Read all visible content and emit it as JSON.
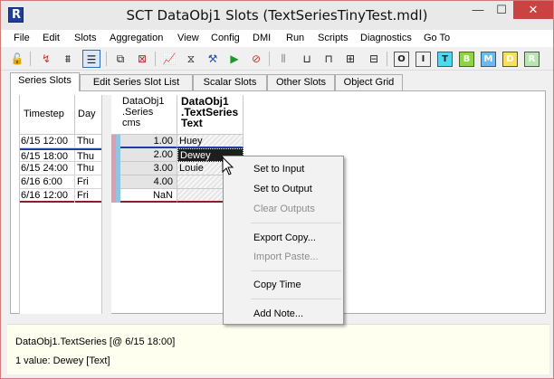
{
  "window": {
    "title": "SCT DataObj1 Slots (TextSeriesTinyTest.mdl)",
    "minimize": "—",
    "maximize": "☐",
    "close": "✕"
  },
  "menu": [
    "File",
    "Edit",
    "Slots",
    "Aggregation",
    "View",
    "Config",
    "DMI",
    "Run",
    "Scripts",
    "Diagnostics",
    "Go To"
  ],
  "toolbar": {
    "icons": [
      "lock-icon",
      "dependency-icon",
      "filter-icon",
      "list-view-icon",
      "open-object-icon",
      "close-object-icon",
      "plot-icon",
      "timestep-icon",
      "wrench-icon",
      "run-icon",
      "stop-icon",
      "grid-icon",
      "dock-bottom-icon",
      "dock-top-icon",
      "fit-icon",
      "hide-icon"
    ],
    "letter_buttons": [
      {
        "label": "O",
        "color": "#ffffff"
      },
      {
        "label": "I",
        "color": "#ffffff"
      },
      {
        "label": "T",
        "color": "#4fd9ee"
      },
      {
        "label": "B",
        "color": "#8ed545"
      },
      {
        "label": "M",
        "color": "#6fb8ee"
      },
      {
        "label": "D",
        "color": "#f6e05e"
      },
      {
        "label": "R",
        "color": "#b8e6b0"
      }
    ]
  },
  "tabs": [
    "Series Slots",
    "Edit Series Slot List",
    "Scalar Slots",
    "Other Slots",
    "Object Grid"
  ],
  "timestep_table": {
    "headers": [
      "Timestep",
      "Day"
    ],
    "rows": [
      {
        "timestep": "6/15 12:00",
        "day": "Thu"
      },
      {
        "timestep": "6/15 18:00",
        "day": "Thu"
      },
      {
        "timestep": "6/15 24:00",
        "day": "Thu"
      },
      {
        "timestep": "6/16 6:00",
        "day": "Fri"
      },
      {
        "timestep": "6/16 12:00",
        "day": "Fri"
      }
    ]
  },
  "grid": {
    "columns": [
      {
        "lines": [
          "DataObj1",
          ".Series",
          "cms"
        ]
      },
      {
        "lines": [
          "DataObj1",
          ".TextSeries",
          "Text"
        ]
      }
    ],
    "rows": [
      {
        "series": "1.00",
        "text": "Huey"
      },
      {
        "series": "2.00",
        "text": "Dewey"
      },
      {
        "series": "3.00",
        "text": "Louie"
      },
      {
        "series": "4.00",
        "text": ""
      },
      {
        "series": "NaN",
        "text": ""
      }
    ],
    "selected_row": 1
  },
  "context_menu": {
    "items": [
      {
        "label": "Set to Input",
        "enabled": true
      },
      {
        "label": "Set to Output",
        "enabled": true
      },
      {
        "label": "Clear Outputs",
        "enabled": false
      },
      {
        "label": "Export Copy...",
        "enabled": true
      },
      {
        "label": "Import Paste...",
        "enabled": false
      },
      {
        "label": "Copy Time",
        "enabled": true
      },
      {
        "label": "Add Note...",
        "enabled": true
      }
    ]
  },
  "status": {
    "line1": "DataObj1.TextSeries [@ 6/15 18:00]",
    "line2": "1 value:  Dewey [Text]"
  },
  "colors": {
    "accent_blue": "#2d6dc4",
    "row_marker_red": "#d8a0b0",
    "row_marker_blue": "#8fc5e0",
    "close_button": "#c84342",
    "status_bg": "#fffff0"
  }
}
